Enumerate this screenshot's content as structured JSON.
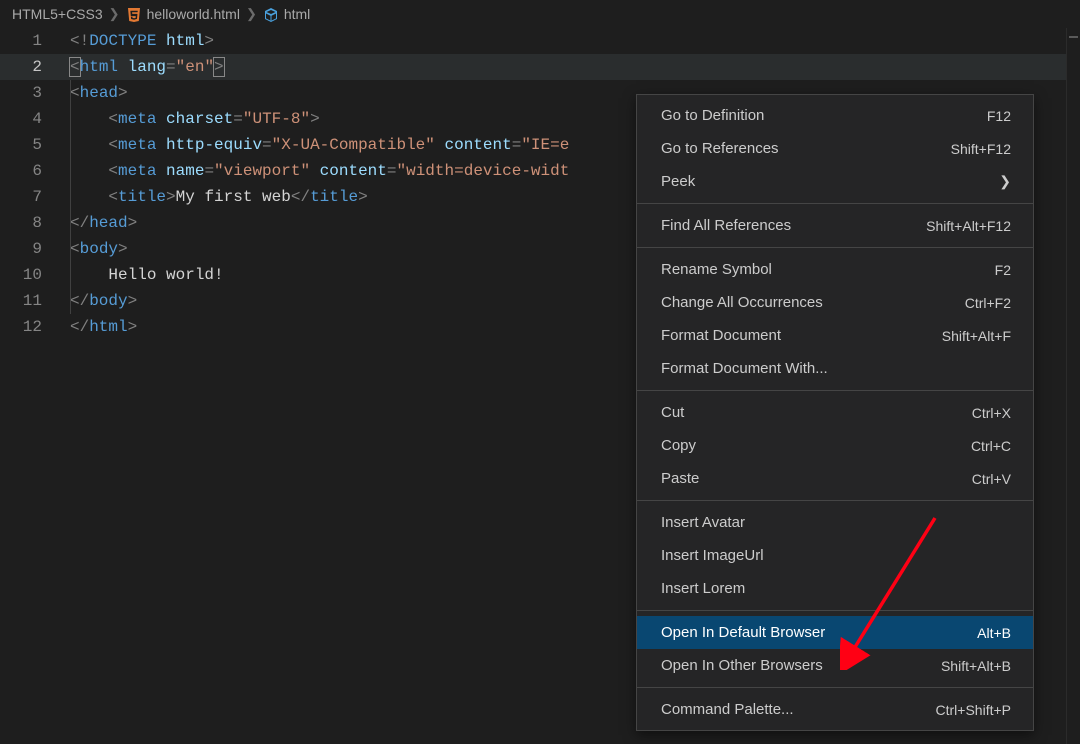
{
  "breadcrumbs": {
    "root": "HTML5+CSS3",
    "file": "helloworld.html",
    "symbol": "html"
  },
  "editor": {
    "active_line": 2,
    "lines": [
      {
        "n": 1,
        "tokens": [
          [
            "p",
            "<!"
          ],
          [
            "dk",
            "DOCTYPE "
          ],
          [
            "a",
            "html"
          ],
          [
            "p",
            ">"
          ]
        ]
      },
      {
        "n": 2,
        "bracket": true,
        "tokens": [
          [
            "p",
            "<"
          ],
          [
            "t",
            "html "
          ],
          [
            "a",
            "lang"
          ],
          [
            "p",
            "="
          ],
          [
            "s",
            "\"en\""
          ],
          [
            "p",
            ">"
          ]
        ]
      },
      {
        "n": 3,
        "indent": 1,
        "tokens": [
          [
            "p",
            "<"
          ],
          [
            "t",
            "head"
          ],
          [
            "p",
            ">"
          ]
        ]
      },
      {
        "n": 4,
        "indent": 1,
        "tokens": [
          [
            "tx",
            "    "
          ],
          [
            "p",
            "<"
          ],
          [
            "t",
            "meta "
          ],
          [
            "a",
            "charset"
          ],
          [
            "p",
            "="
          ],
          [
            "s",
            "\"UTF-8\""
          ],
          [
            "p",
            ">"
          ]
        ]
      },
      {
        "n": 5,
        "indent": 1,
        "tokens": [
          [
            "tx",
            "    "
          ],
          [
            "p",
            "<"
          ],
          [
            "t",
            "meta "
          ],
          [
            "a",
            "http-equiv"
          ],
          [
            "p",
            "="
          ],
          [
            "s",
            "\"X-UA-Compatible\" "
          ],
          [
            "a",
            "content"
          ],
          [
            "p",
            "="
          ],
          [
            "s",
            "\"IE=e"
          ]
        ]
      },
      {
        "n": 6,
        "indent": 1,
        "tokens": [
          [
            "tx",
            "    "
          ],
          [
            "p",
            "<"
          ],
          [
            "t",
            "meta "
          ],
          [
            "a",
            "name"
          ],
          [
            "p",
            "="
          ],
          [
            "s",
            "\"viewport\" "
          ],
          [
            "a",
            "content"
          ],
          [
            "p",
            "="
          ],
          [
            "s",
            "\"width=device-widt"
          ]
        ]
      },
      {
        "n": 7,
        "indent": 1,
        "tokens": [
          [
            "tx",
            "    "
          ],
          [
            "p",
            "<"
          ],
          [
            "t",
            "title"
          ],
          [
            "p",
            ">"
          ],
          [
            "tx",
            "My first web"
          ],
          [
            "p",
            "</"
          ],
          [
            "t",
            "title"
          ],
          [
            "p",
            ">"
          ]
        ]
      },
      {
        "n": 8,
        "indent": 1,
        "tokens": [
          [
            "p",
            "</"
          ],
          [
            "t",
            "head"
          ],
          [
            "p",
            ">"
          ]
        ]
      },
      {
        "n": 9,
        "indent": 1,
        "tokens": [
          [
            "p",
            "<"
          ],
          [
            "t",
            "body"
          ],
          [
            "p",
            ">"
          ]
        ]
      },
      {
        "n": 10,
        "indent": 1,
        "tokens": [
          [
            "tx",
            "    Hello world!"
          ]
        ]
      },
      {
        "n": 11,
        "indent": 1,
        "tokens": [
          [
            "p",
            "</"
          ],
          [
            "t",
            "body"
          ],
          [
            "p",
            ">"
          ]
        ]
      },
      {
        "n": 12,
        "tokens": [
          [
            "p",
            "</"
          ],
          [
            "t",
            "html"
          ],
          [
            "p",
            ">"
          ]
        ]
      }
    ]
  },
  "context_menu": {
    "items": [
      {
        "label": "Go to Definition",
        "shortcut": "F12"
      },
      {
        "label": "Go to References",
        "shortcut": "Shift+F12"
      },
      {
        "label": "Peek",
        "submenu": true
      },
      {
        "sep": true
      },
      {
        "label": "Find All References",
        "shortcut": "Shift+Alt+F12"
      },
      {
        "sep": true
      },
      {
        "label": "Rename Symbol",
        "shortcut": "F2"
      },
      {
        "label": "Change All Occurrences",
        "shortcut": "Ctrl+F2"
      },
      {
        "label": "Format Document",
        "shortcut": "Shift+Alt+F"
      },
      {
        "label": "Format Document With..."
      },
      {
        "sep": true
      },
      {
        "label": "Cut",
        "shortcut": "Ctrl+X"
      },
      {
        "label": "Copy",
        "shortcut": "Ctrl+C"
      },
      {
        "label": "Paste",
        "shortcut": "Ctrl+V"
      },
      {
        "sep": true
      },
      {
        "label": "Insert Avatar"
      },
      {
        "label": "Insert ImageUrl"
      },
      {
        "label": "Insert Lorem"
      },
      {
        "sep": true
      },
      {
        "label": "Open In Default Browser",
        "shortcut": "Alt+B",
        "highlight": true
      },
      {
        "label": "Open In Other Browsers",
        "shortcut": "Shift+Alt+B"
      },
      {
        "sep": true
      },
      {
        "label": "Command Palette...",
        "shortcut": "Ctrl+Shift+P"
      }
    ]
  }
}
